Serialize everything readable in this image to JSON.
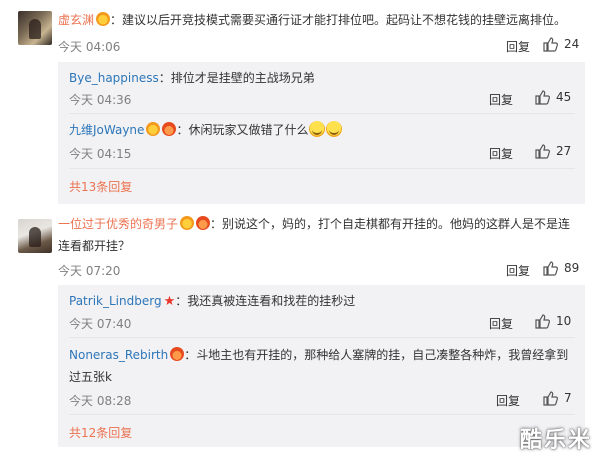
{
  "comments": [
    {
      "user": "虚玄渊",
      "text": "：建议以后开竞技模式需要买通行证才能打排位吧。起码让不想花钱的挂壁远离排位。",
      "time": "今天 04:06",
      "reply_label": "回复",
      "likes": "24",
      "badges": [
        "crown-badge-icon"
      ],
      "replies": [
        {
          "user": "Bye_happiness",
          "text": "：排位才是挂壁的主战场兄弟",
          "time": "今天 04:36",
          "reply_label": "回复",
          "likes": "45",
          "badges": []
        },
        {
          "user": "九维JoWayne",
          "text": "：休闲玩家又做错了什么",
          "time": "今天 04:15",
          "reply_label": "回复",
          "likes": "27",
          "badges": [
            "crown-badge-icon",
            "flame-badge-icon"
          ],
          "emojis": [
            "grin-emoji-icon",
            "grin-emoji-icon"
          ]
        }
      ],
      "more": "共13条回复"
    },
    {
      "user": "一位过于优秀的奇男子",
      "text_line1": "：别说这个，妈的，打个自走棋都有开挂的。他妈的这群人是不是连",
      "text_line2": "连看都开挂？",
      "time": "今天 07:20",
      "reply_label": "回复",
      "likes": "89",
      "badges": [
        "crown-badge-icon",
        "flame-badge-icon"
      ],
      "replies": [
        {
          "user": "Patrik_Lindberg",
          "text": "：我还真被连连看和找茬的挂秒过",
          "time": "今天 07:40",
          "reply_label": "回复",
          "likes": "10",
          "badges": [
            "star-badge-icon"
          ]
        },
        {
          "user": "Noneras_Rebirth",
          "text_line1": "：斗地主也有开挂的，那种给人塞牌的挂，自己凑整各种炸，我曾经拿到",
          "text_line2": "过五张k",
          "time": "今天 08:28",
          "reply_label": "回复",
          "likes": "7",
          "badges": [
            "flame-badge-icon"
          ]
        }
      ],
      "more": "共12条回复"
    }
  ],
  "colors": {
    "username_orange": "#eb7350",
    "username_blue": "#2d76b8",
    "reply_bg": "#f2f2f5",
    "muted": "#808080"
  },
  "watermark": "酷乐米"
}
